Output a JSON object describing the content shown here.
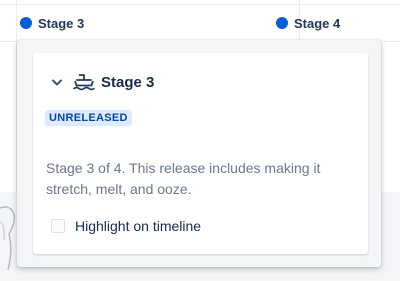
{
  "timeline": {
    "markers": [
      {
        "label": "Stage 3",
        "color": "#0b5ed7"
      },
      {
        "label": "Stage 4",
        "color": "#0b5ed7"
      }
    ]
  },
  "popup": {
    "title": "Stage 3",
    "status_badge": "UNRELEASED",
    "description": "Stage 3 of 4. This release includes making it stretch, melt, and ooze.",
    "highlight_label": "Highlight on timeline",
    "highlight_checked": false,
    "icons": {
      "collapse": "chevron-down-icon",
      "release": "ship-icon"
    }
  },
  "colors": {
    "accent": "#0b5ed7",
    "badge_bg": "#deebff",
    "badge_text": "#0747a6"
  }
}
